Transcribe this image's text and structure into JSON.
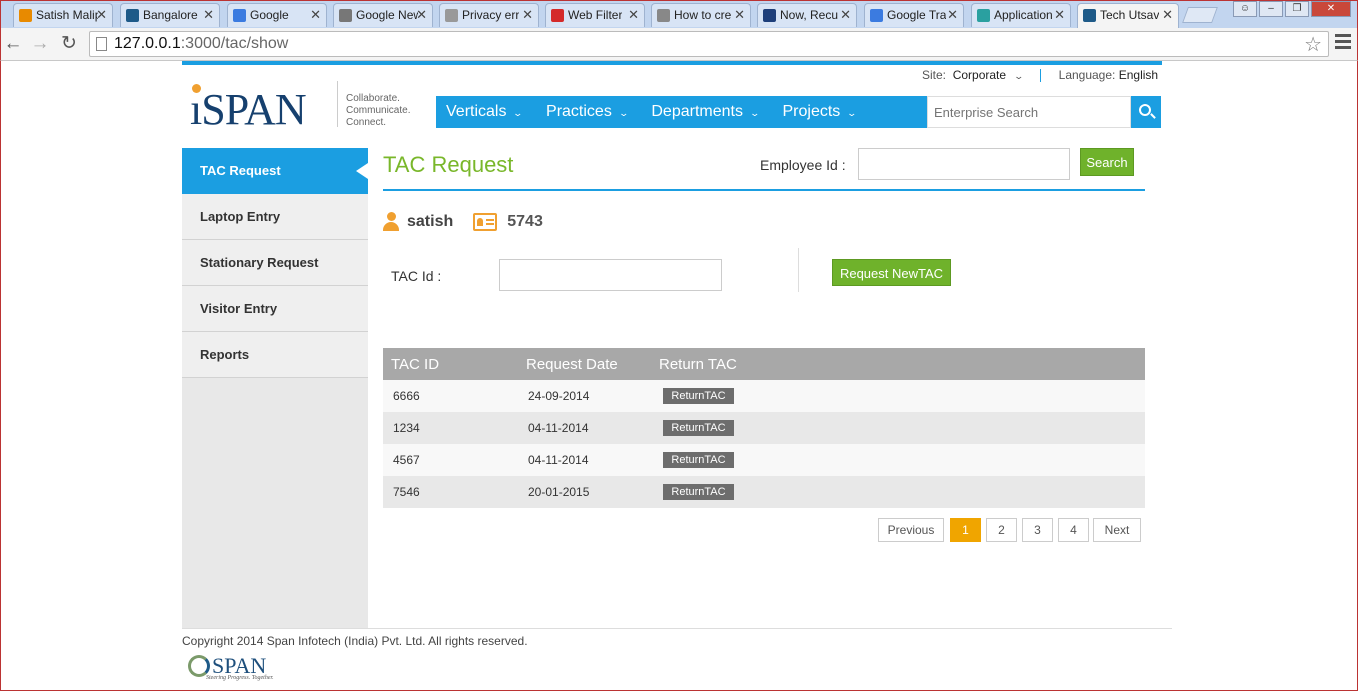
{
  "browser": {
    "tabs": [
      {
        "label": "Satish Malip",
        "icon": "outlook-icon",
        "color": "#e88a00"
      },
      {
        "label": "Bangalore",
        "icon": "span-person-icon",
        "color": "#1e5a88"
      },
      {
        "label": "Google",
        "icon": "google-icon",
        "color": "#3b7be0"
      },
      {
        "label": "Google New",
        "icon": "news-icon",
        "color": "#777777"
      },
      {
        "label": "Privacy err",
        "icon": "page-icon",
        "color": "#999999"
      },
      {
        "label": "Web Filter",
        "icon": "zscaler-icon",
        "color": "#d42a2a"
      },
      {
        "label": "How to cre",
        "icon": "chart-page-icon",
        "color": "#888888"
      },
      {
        "label": "Now, Recu",
        "icon": "n-icon",
        "color": "#1e3f7a"
      },
      {
        "label": "Google Tra",
        "icon": "translate-icon",
        "color": "#3b7be0"
      },
      {
        "label": "Application",
        "icon": "app-icon",
        "color": "#2aa0a0"
      },
      {
        "label": "Tech Utsav",
        "icon": "span-person-icon",
        "color": "#1e5a88"
      }
    ],
    "url_host": "127.0.0.1",
    "url_path": ":3000/tac/show"
  },
  "header": {
    "site_label": "Site:",
    "site_value": "Corporate",
    "language_label": "Language:",
    "language_value": "English",
    "logo_text": "SPAN",
    "tagline": [
      "Collaborate.",
      "Communicate.",
      "Connect."
    ],
    "nav": [
      "Verticals",
      "Practices",
      "Departments",
      "Projects"
    ],
    "search_placeholder": "Enterprise Search"
  },
  "sidebar": {
    "items": [
      {
        "label": "TAC Request",
        "active": true
      },
      {
        "label": "Laptop Entry",
        "active": false
      },
      {
        "label": "Stationary Request",
        "active": false
      },
      {
        "label": "Visitor Entry",
        "active": false
      },
      {
        "label": "Reports",
        "active": false
      }
    ]
  },
  "main": {
    "title": "TAC Request",
    "employee_id_label": "Employee Id :",
    "search_label": "Search",
    "user_name": "satish",
    "employee_number": "5743",
    "tac_id_label": "TAC Id :",
    "request_button": "Request NewTAC",
    "table": {
      "headers": [
        "TAC ID",
        "Request Date",
        "Return TAC"
      ],
      "rows": [
        {
          "tac_id": "6666",
          "date": "24-09-2014",
          "action": "ReturnTAC"
        },
        {
          "tac_id": "1234",
          "date": "04-11-2014",
          "action": "ReturnTAC"
        },
        {
          "tac_id": "4567",
          "date": "04-11-2014",
          "action": "ReturnTAC"
        },
        {
          "tac_id": "7546",
          "date": "20-01-2015",
          "action": "ReturnTAC"
        }
      ]
    },
    "pager": {
      "previous": "Previous",
      "pages": [
        "1",
        "2",
        "3",
        "4"
      ],
      "current": "1",
      "next": "Next"
    }
  },
  "footer": {
    "copyright": "Copyright 2014 Span Infotech (India) Pvt. Ltd. All rights reserved.",
    "logo_text": "SPAN",
    "logo_tagline": "Steering Progress. Together."
  },
  "colors": {
    "accent_blue": "#1b9ee1",
    "accent_green": "#6fb22b",
    "title_green": "#79b72a",
    "pager_active": "#f0a500"
  }
}
